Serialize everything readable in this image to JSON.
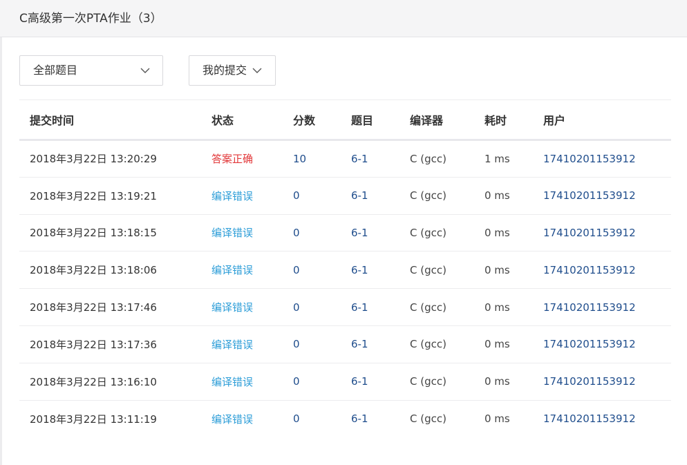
{
  "header": {
    "title": "C高级第一次PTA作业（3）"
  },
  "filters": {
    "problems": {
      "label": "全部题目",
      "icon": "chevron-down-icon"
    },
    "submissions": {
      "label": "我的提交",
      "icon": "chevron-down-icon"
    }
  },
  "table": {
    "columns": [
      "提交时间",
      "状态",
      "分数",
      "题目",
      "编译器",
      "耗时",
      "用户"
    ],
    "rows": [
      {
        "time": "2018年3月22日 13:20:29",
        "status": "答案正确",
        "score": "10",
        "problem": "6-1",
        "compiler": "C (gcc)",
        "duration": "1 ms",
        "user": "17410201153912"
      },
      {
        "time": "2018年3月22日 13:19:21",
        "status": "编译错误",
        "score": "0",
        "problem": "6-1",
        "compiler": "C (gcc)",
        "duration": "0 ms",
        "user": "17410201153912"
      },
      {
        "time": "2018年3月22日 13:18:15",
        "status": "编译错误",
        "score": "0",
        "problem": "6-1",
        "compiler": "C (gcc)",
        "duration": "0 ms",
        "user": "17410201153912"
      },
      {
        "time": "2018年3月22日 13:18:06",
        "status": "编译错误",
        "score": "0",
        "problem": "6-1",
        "compiler": "C (gcc)",
        "duration": "0 ms",
        "user": "17410201153912"
      },
      {
        "time": "2018年3月22日 13:17:46",
        "status": "编译错误",
        "score": "0",
        "problem": "6-1",
        "compiler": "C (gcc)",
        "duration": "0 ms",
        "user": "17410201153912"
      },
      {
        "time": "2018年3月22日 13:17:36",
        "status": "编译错误",
        "score": "0",
        "problem": "6-1",
        "compiler": "C (gcc)",
        "duration": "0 ms",
        "user": "17410201153912"
      },
      {
        "time": "2018年3月22日 13:16:10",
        "status": "编译错误",
        "score": "0",
        "problem": "6-1",
        "compiler": "C (gcc)",
        "duration": "0 ms",
        "user": "17410201153912"
      },
      {
        "time": "2018年3月22日 13:11:19",
        "status": "编译错误",
        "score": "0",
        "problem": "6-1",
        "compiler": "C (gcc)",
        "duration": "0 ms",
        "user": "17410201153912"
      }
    ]
  },
  "colors": {
    "accepted": "#e2383a",
    "compile_error": "#2e9ed8",
    "link": "#1f4d8c"
  }
}
